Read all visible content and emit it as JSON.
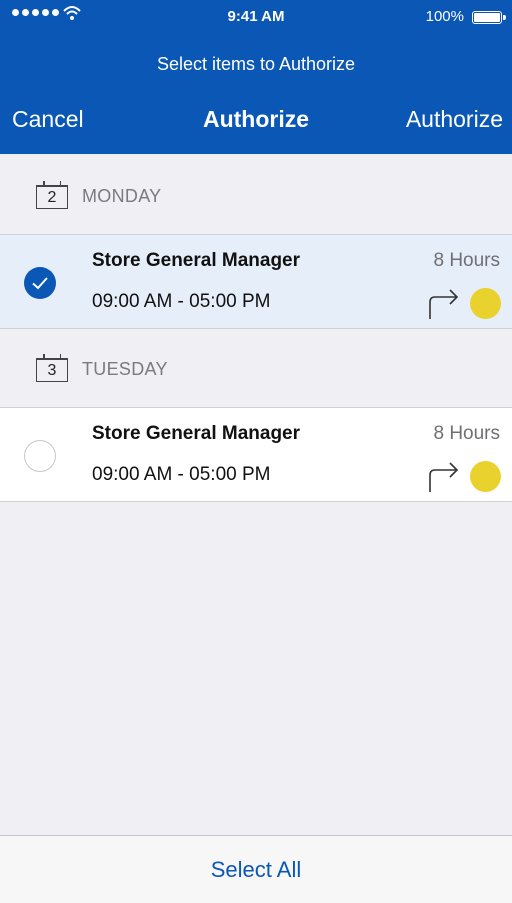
{
  "status_bar": {
    "time": "9:41 AM",
    "battery": "100%"
  },
  "header": {
    "subtitle": "Select items to Authorize",
    "cancel_label": "Cancel",
    "title": "Authorize",
    "action_label": "Authorize"
  },
  "sections": [
    {
      "calendar_day": "2",
      "day_label": "MONDAY",
      "shift": {
        "selected": true,
        "role": "Store General Manager",
        "hours": "8 Hours",
        "time_range": "09:00 AM - 05:00 PM",
        "status_color": "#ead22e"
      }
    },
    {
      "calendar_day": "3",
      "day_label": "TUESDAY",
      "shift": {
        "selected": false,
        "role": "Store General Manager",
        "hours": "8 Hours",
        "time_range": "09:00 AM - 05:00 PM",
        "status_color": "#ead22e"
      }
    }
  ],
  "footer": {
    "select_all_label": "Select All"
  },
  "colors": {
    "brand": "#0a57b5",
    "background": "#efeff4",
    "selected_row": "#e6eefa",
    "status_dot": "#ead22e"
  },
  "icons": [
    "signal-dots-icon",
    "wifi-icon",
    "battery-icon",
    "calendar-icon",
    "checkmark-icon",
    "forward-arrow-icon",
    "status-dot-icon"
  ]
}
